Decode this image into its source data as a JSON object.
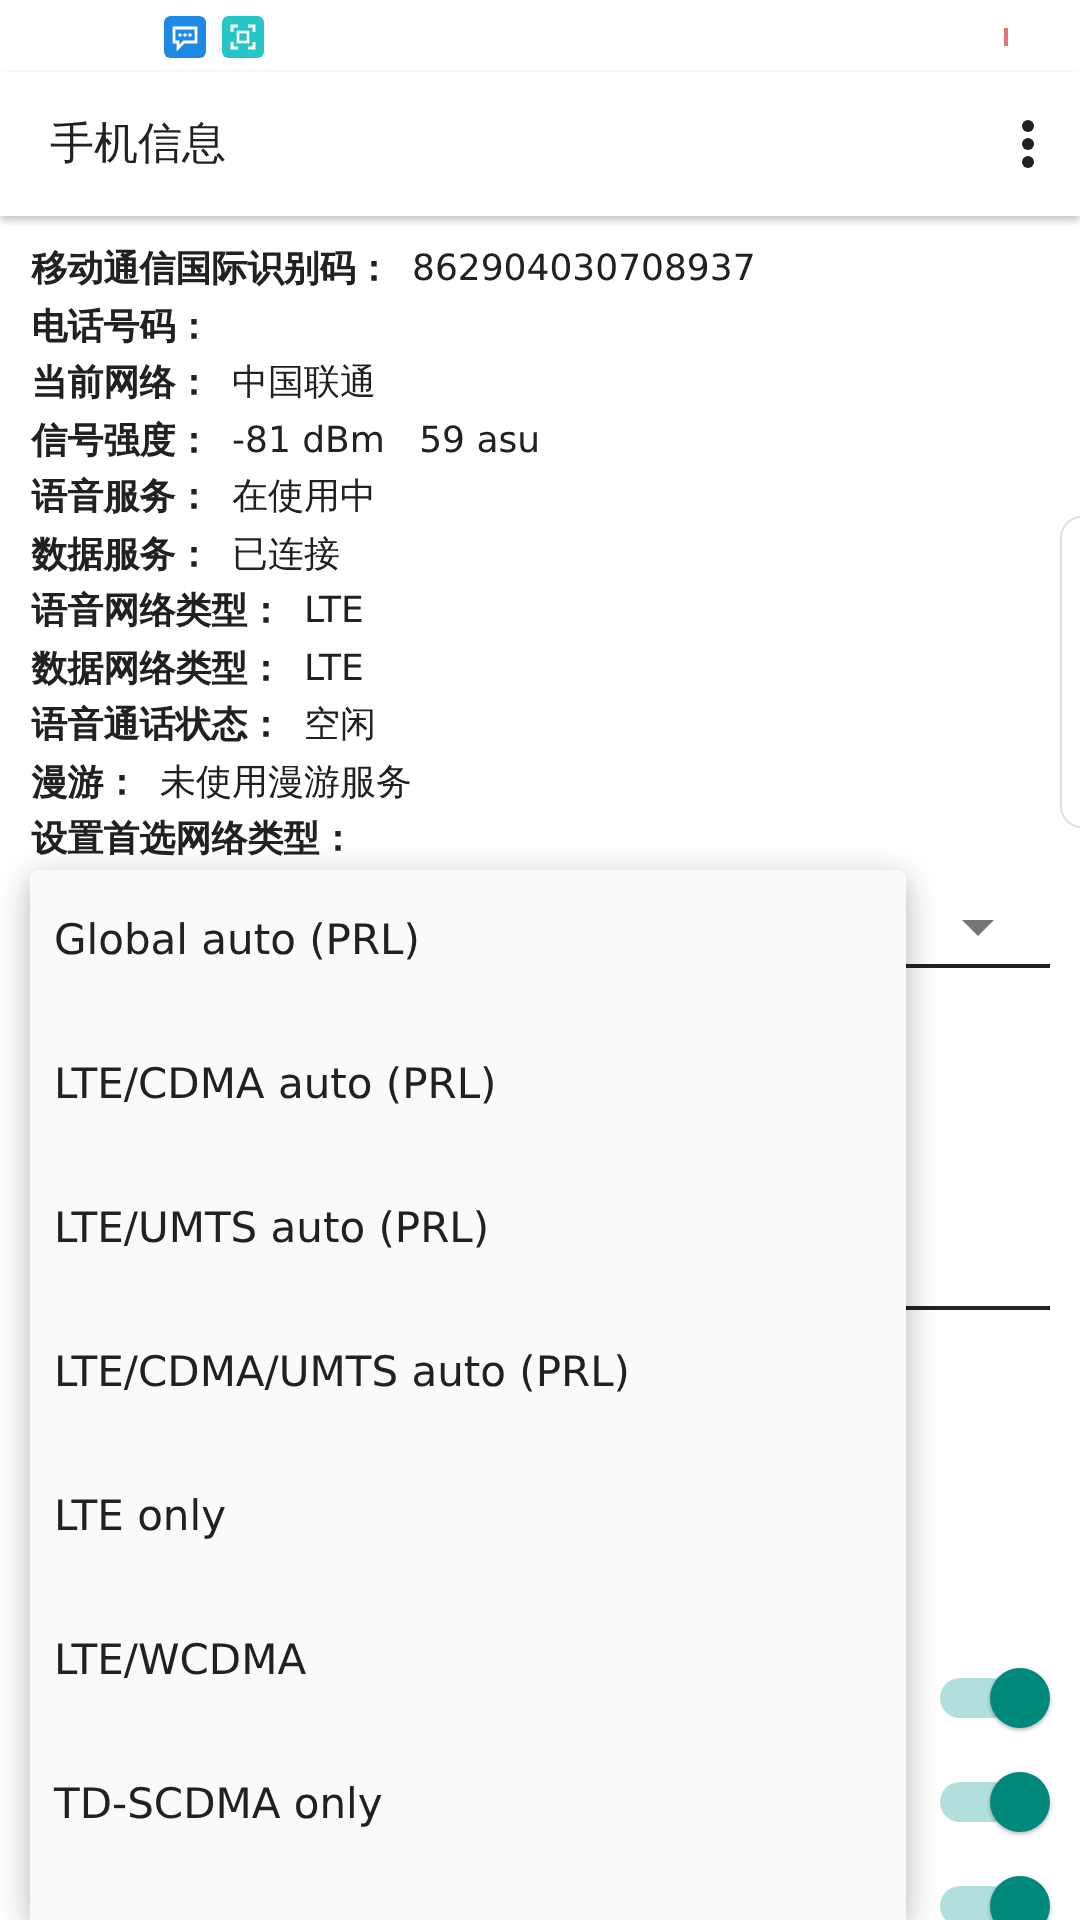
{
  "app_bar": {
    "title": "手机信息"
  },
  "info": [
    {
      "label": "移动通信国际识别码：",
      "value": "862904030708937"
    },
    {
      "label": "电话号码："
    },
    {
      "label": "当前网络：",
      "value": "中国联通"
    },
    {
      "label": "信号强度：",
      "value": "-81 dBm   59 asu"
    },
    {
      "label": "语音服务：",
      "value": "在使用中"
    },
    {
      "label": "数据服务：",
      "value": "已连接"
    },
    {
      "label": "语音网络类型：",
      "value": "LTE"
    },
    {
      "label": "数据网络类型：",
      "value": "LTE"
    },
    {
      "label": "语音通话状态：",
      "value": "空闲"
    },
    {
      "label": "漫游：",
      "value": "未使用漫游服务"
    },
    {
      "label": "设置首选网络类型："
    }
  ],
  "toggles": [
    {
      "on": true
    },
    {
      "on": true
    },
    {
      "on": true
    }
  ],
  "dropdown": {
    "options": [
      "Global auto (PRL)",
      "LTE/CDMA auto (PRL)",
      "LTE/UMTS auto (PRL)",
      "LTE/CDMA/UMTS auto (PRL)",
      "LTE only",
      "LTE/WCDMA",
      "TD-SCDMA only"
    ]
  }
}
